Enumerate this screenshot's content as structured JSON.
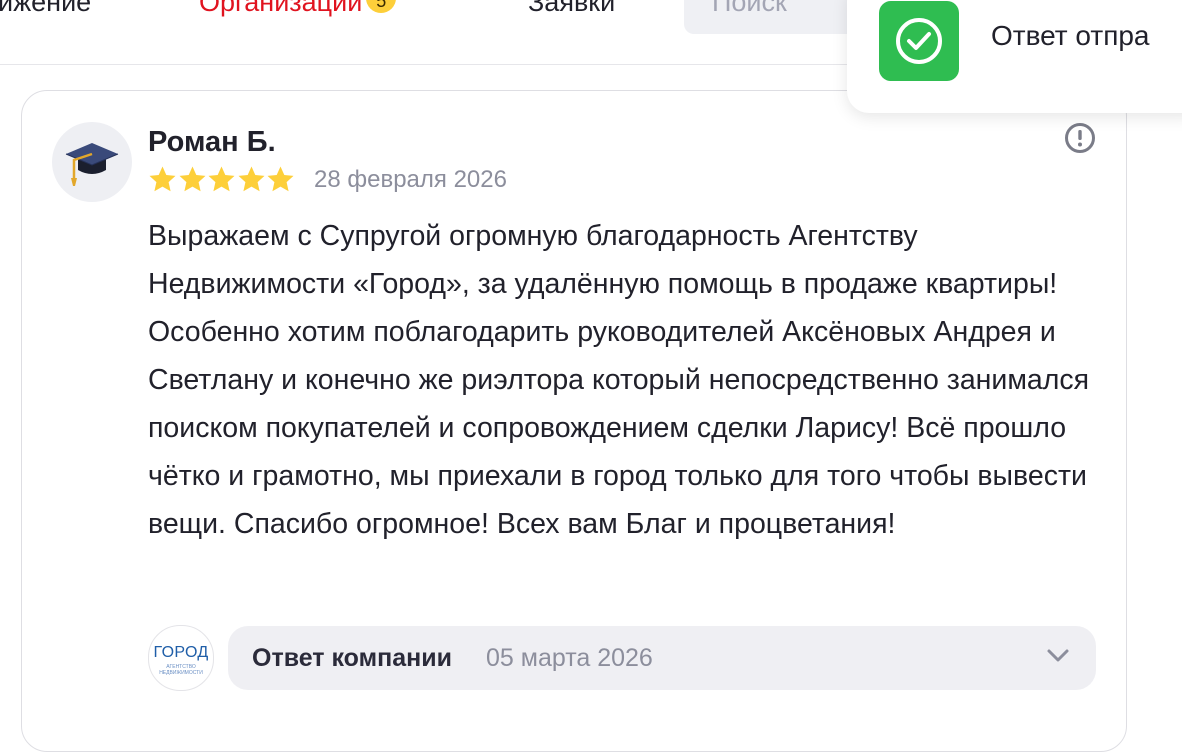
{
  "nav": {
    "items": [
      {
        "label": "ижение"
      },
      {
        "label": "Организации",
        "badge": "5"
      },
      {
        "label": "Заявки"
      }
    ],
    "search_placeholder": "Поиск"
  },
  "toast": {
    "text": "Ответ отпра",
    "icon": "check-circle-icon",
    "color": "#2fbd51"
  },
  "review": {
    "author": "Роман Б.",
    "rating": 5,
    "rating_max": 5,
    "date": "28 февраля 2026",
    "text": "Выражаем с Супругой огромную благодарность Агентству Недвижимости «Город», за удалённую помощь в продаже квартиры! Особенно хотим поблагодарить руководителей Аксёновых Андрея и Светлану и конечно же риэлтора который непосредственно занимался поиском покупателей и сопровождением сделки Ларису! Всё прошло чётко и грамотно, мы приехали в город только для того чтобы вывести вещи. Спасибо огромное! Всех вам Благ и процветания!",
    "avatar_icon": "graduation-cap-icon",
    "report_icon": "exclamation-circle-icon"
  },
  "company_answer": {
    "logo_text": "ГОРОД",
    "logo_subtext": "АГЕНТСТВО НЕДВИЖИМОСТИ",
    "label": "Ответ компании",
    "date": "05 марта 2026",
    "expand_icon": "chevron-down-icon"
  },
  "colors": {
    "accent_red": "#e0131f",
    "star_yellow": "#fdcf3a",
    "badge_yellow": "#fdcf3a",
    "success_green": "#2fbd51"
  }
}
